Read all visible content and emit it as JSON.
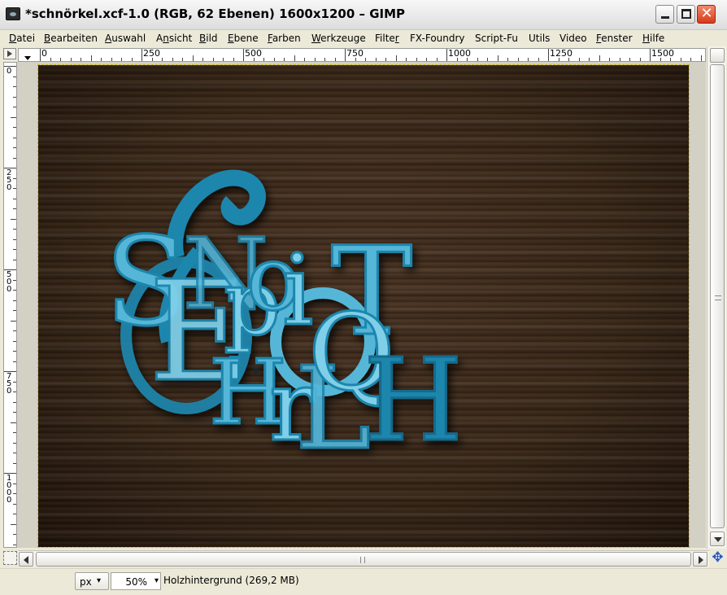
{
  "window": {
    "title": "*schnörkel.xcf-1.0 (RGB, 62 Ebenen) 1600x1200 – GIMP",
    "close_glyph": "✕"
  },
  "menu": {
    "items": [
      {
        "label": "Datei",
        "underline": "D"
      },
      {
        "label": "Bearbeiten",
        "underline": "B"
      },
      {
        "label": "Auswahl",
        "underline": "A"
      },
      {
        "label": "Ansicht",
        "underline": "n"
      },
      {
        "label": "Bild",
        "underline": "B"
      },
      {
        "label": "Ebene",
        "underline": "E"
      },
      {
        "label": "Farben",
        "underline": "F"
      },
      {
        "label": "Werkzeuge",
        "underline": "W"
      },
      {
        "label": "Filter",
        "underline": "r"
      },
      {
        "label": "FX-Foundry",
        "underline": ""
      },
      {
        "label": "Script-Fu",
        "underline": ""
      },
      {
        "label": "Utils",
        "underline": ""
      },
      {
        "label": "Video",
        "underline": ""
      },
      {
        "label": "Fenster",
        "underline": "F"
      },
      {
        "label": "Hilfe",
        "underline": "H"
      }
    ]
  },
  "rulers": {
    "horizontal_labels": [
      "0",
      "250",
      "500",
      "750",
      "1000",
      "1250",
      "1500"
    ],
    "vertical_labels": [
      "0",
      "250",
      "500",
      "750",
      "1000"
    ]
  },
  "canvas": {
    "wood_color": "#3a2818",
    "text_dark": "#1f86ad",
    "text_light": "#56b6d8",
    "text_highlight": "#7fcfe8"
  },
  "status": {
    "unit": "px",
    "zoom": "50%",
    "layer_info": "Holzhintergrund (269,2 MB)"
  },
  "icons": {
    "chevron": "▾",
    "navigate": "✥"
  }
}
